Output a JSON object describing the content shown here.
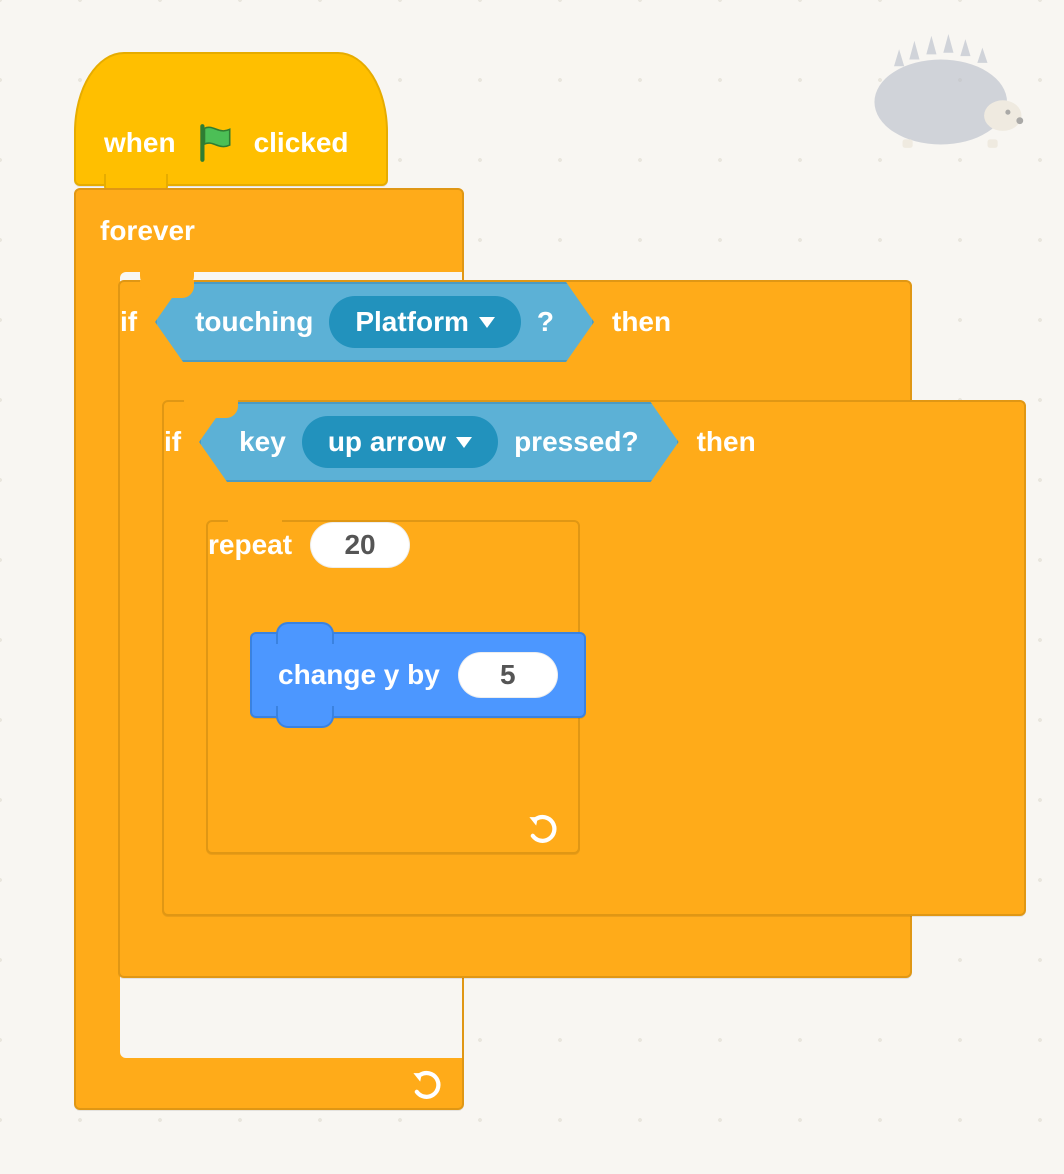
{
  "hat": {
    "prefix": "when",
    "suffix": "clicked",
    "icon": "green-flag-icon"
  },
  "forever": {
    "label": "forever"
  },
  "if1": {
    "keyword_if": "if",
    "keyword_then": "then",
    "sensing": {
      "prefix": "touching",
      "arg": "Platform",
      "suffix": "?"
    }
  },
  "if2": {
    "keyword_if": "if",
    "keyword_then": "then",
    "sensing": {
      "prefix": "key",
      "arg": "up arrow",
      "suffix": "pressed?"
    }
  },
  "repeat": {
    "label": "repeat",
    "count": "20"
  },
  "change": {
    "label": "change y by",
    "value": "5"
  },
  "colors": {
    "events": "#ffbf00",
    "control": "#ffab19",
    "sensing": "#5cb1d6",
    "motion": "#4c97ff"
  },
  "sprite_watermark": "hedgehog"
}
